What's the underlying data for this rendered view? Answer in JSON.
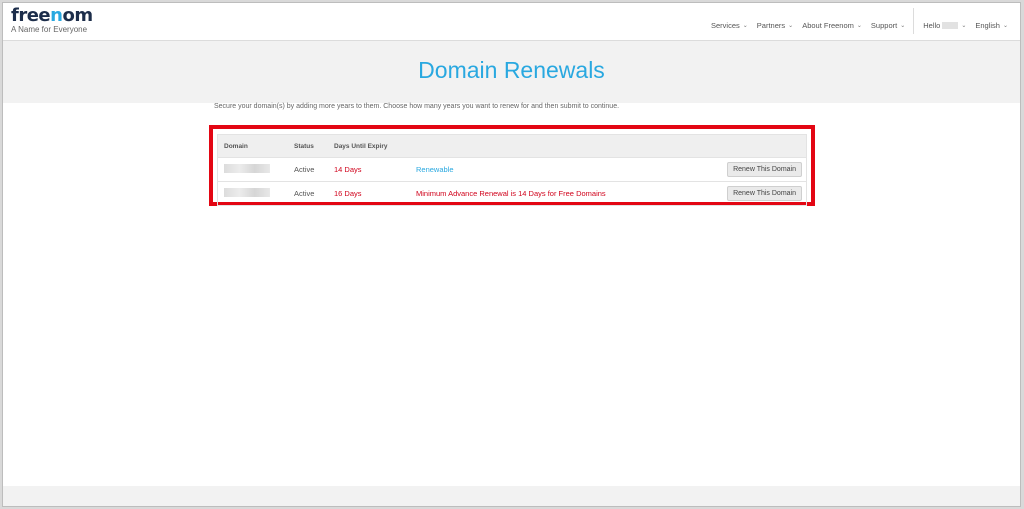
{
  "brand": {
    "logo_text_1": "free",
    "logo_text_o": "n",
    "logo_text_2": "om",
    "tagline": "A Name for Everyone",
    "accent": "#29a8e0",
    "dark": "#1c2d4a"
  },
  "nav": {
    "items": [
      "Services",
      "Partners",
      "About Freenom",
      "Support"
    ],
    "hello_label": "Hello",
    "language": "English",
    "chevron": "chevron-down-icon"
  },
  "hero": {
    "title": "Domain Renewals"
  },
  "intro": "Secure your domain(s) by adding more years to them. Choose how many years you want to renew for and then submit to continue.",
  "table": {
    "headers": [
      "Domain",
      "Status",
      "Days Until Expiry",
      ""
    ],
    "rows": [
      {
        "status": "Active",
        "days": "14 Days",
        "note": "Renewable",
        "note_color": "#29a8e0",
        "button": "Renew This Domain"
      },
      {
        "status": "Active",
        "days": "16 Days",
        "note": "Minimum Advance Renewal is 14 Days for Free Domains",
        "note_color": "#d0021b",
        "button": "Renew This Domain"
      }
    ]
  },
  "highlight_color": "#e30613"
}
